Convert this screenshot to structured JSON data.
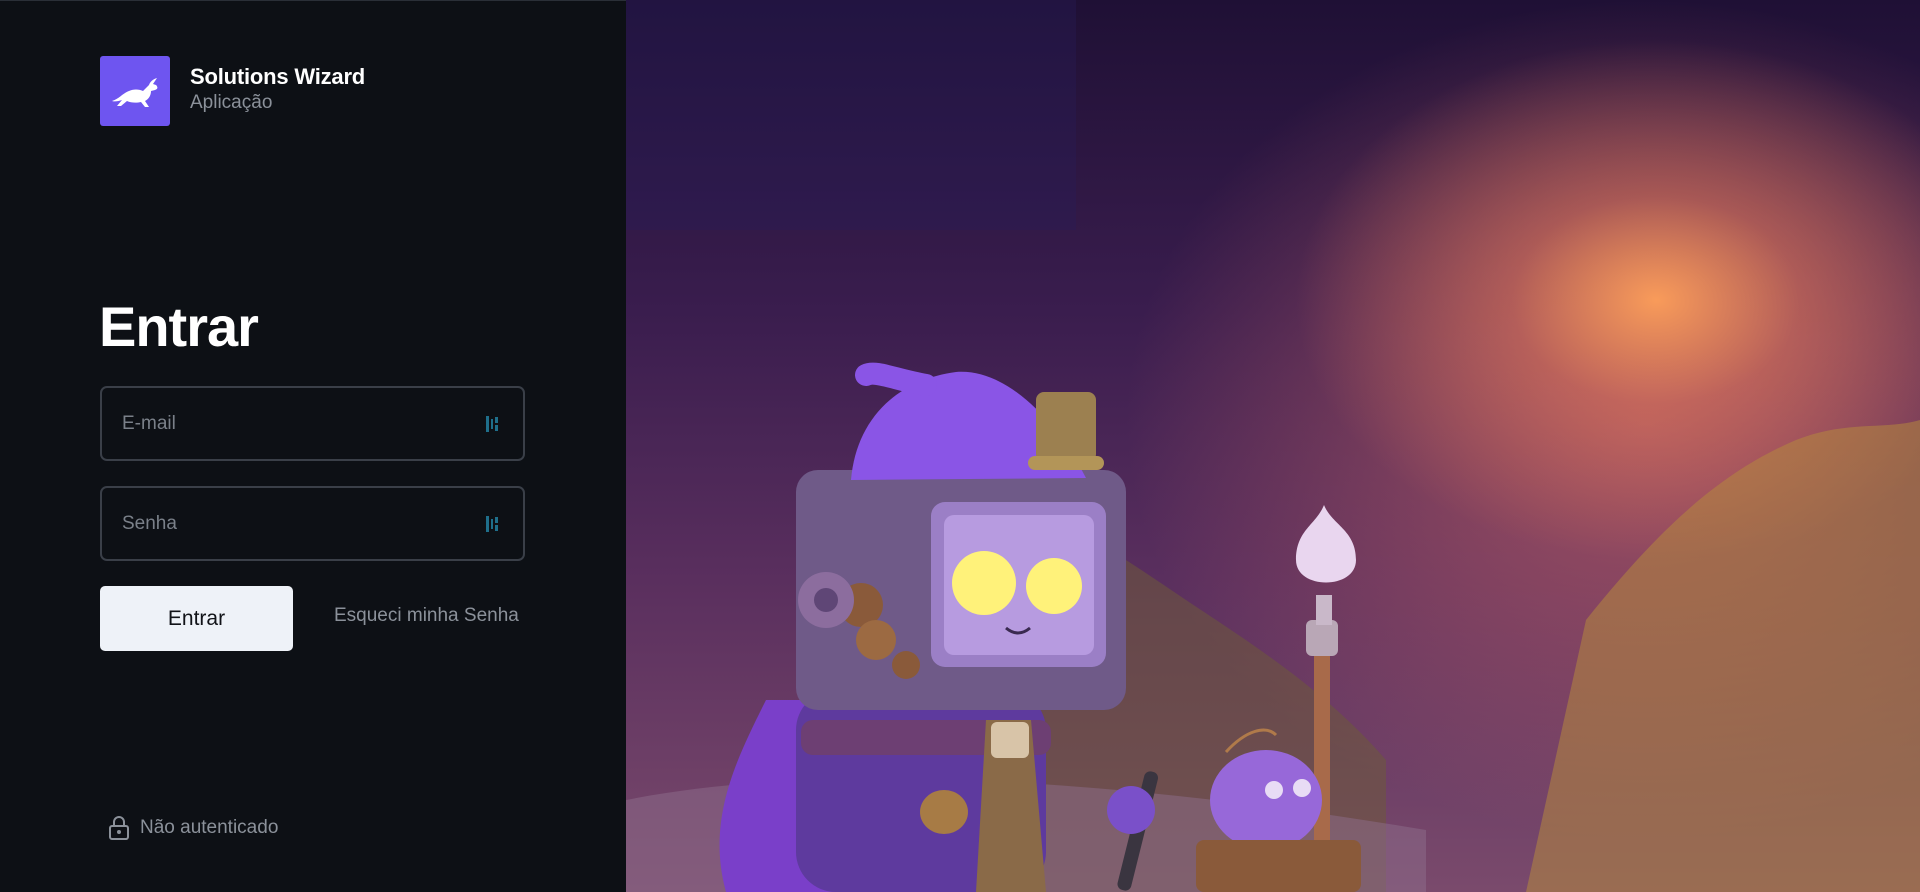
{
  "brand": {
    "name": "Solutions Wizard",
    "subtitle": "Aplicação",
    "logo_icon": "rabbit-icon",
    "accent_color": "#6e55f0"
  },
  "login": {
    "title": "Entrar",
    "email_placeholder": "E-mail",
    "email_value": "",
    "password_placeholder": "Senha",
    "password_value": "",
    "field_icon": "password-manager-icon",
    "submit_label": "Entrar",
    "forgot_label": "Esqueci minha Senha"
  },
  "status": {
    "icon": "lock-icon",
    "text": "Não autenticado"
  },
  "hero": {
    "image": "wizard-robot-illustration"
  }
}
